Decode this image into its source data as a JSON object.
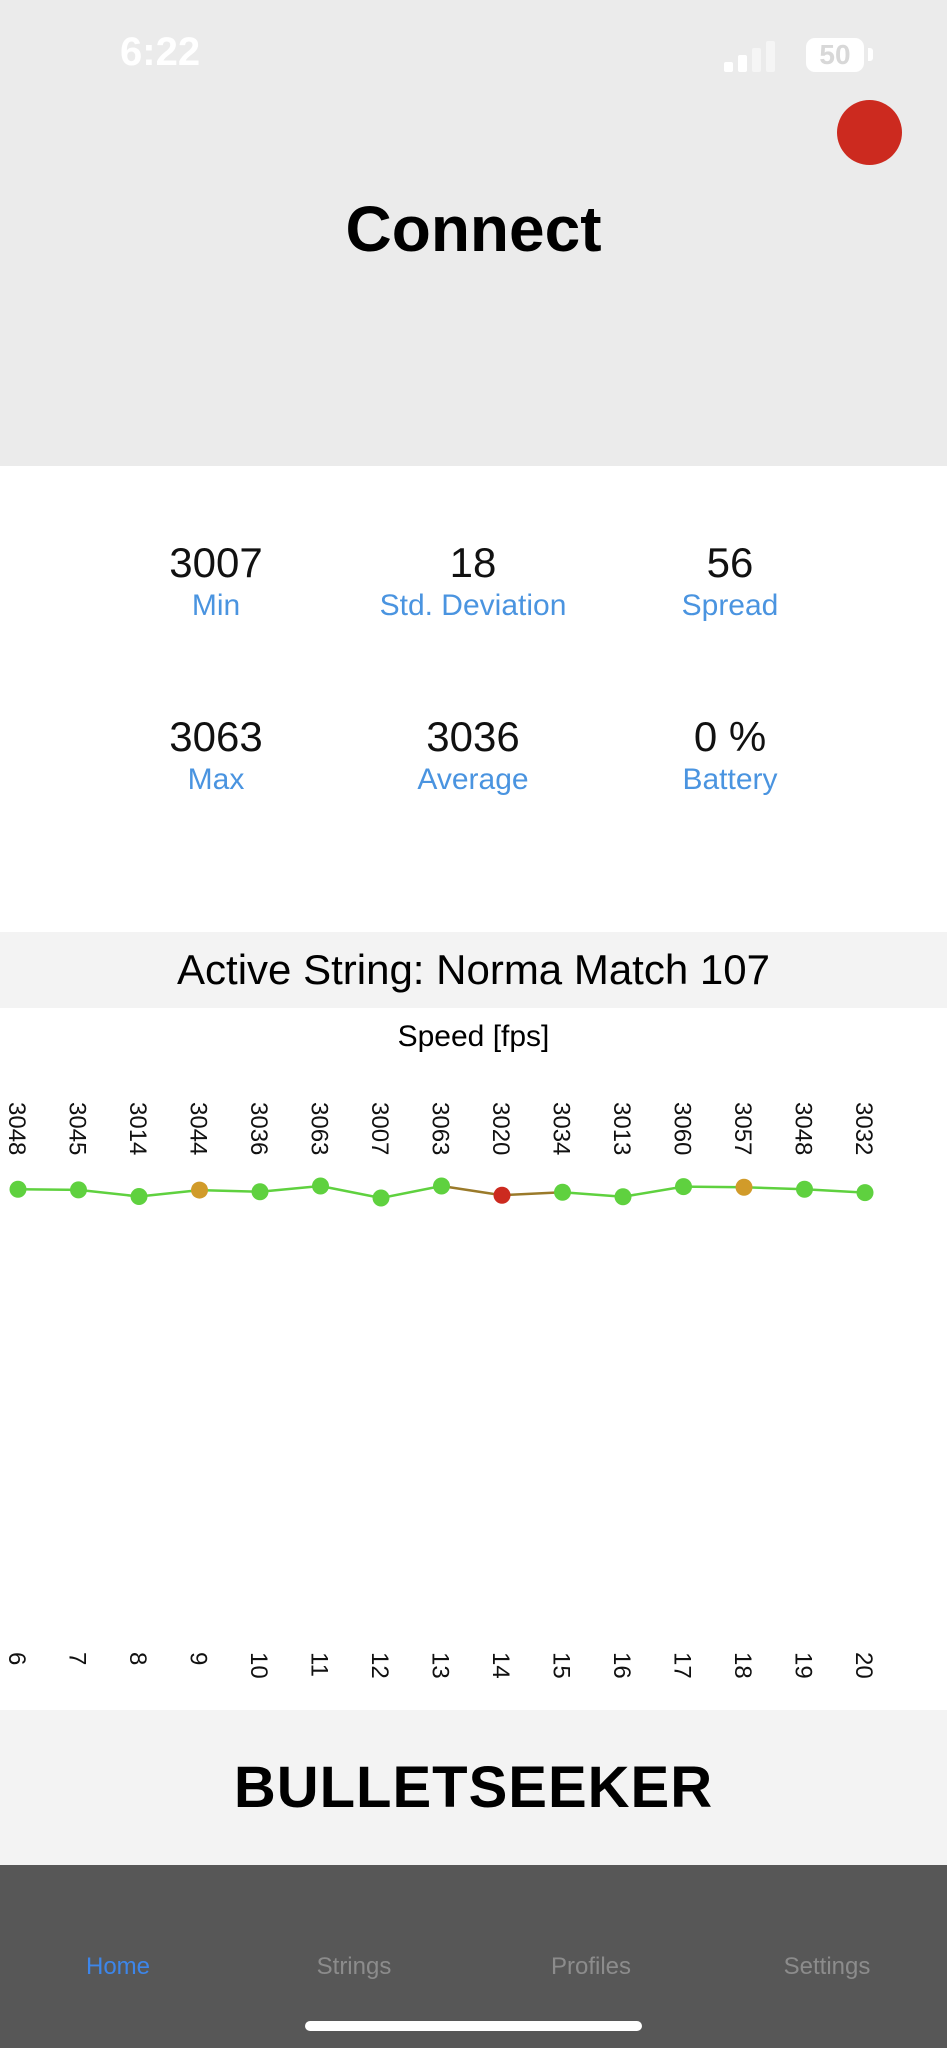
{
  "status_bar": {
    "time": "6:22",
    "battery": "50"
  },
  "header": {
    "title": "Connect"
  },
  "stats": [
    {
      "value": "3007",
      "label": "Min"
    },
    {
      "value": "18",
      "label": "Std. Deviation"
    },
    {
      "value": "56",
      "label": "Spread"
    },
    {
      "value": "3063",
      "label": "Max"
    },
    {
      "value": "3036",
      "label": "Average"
    },
    {
      "value": "0 %",
      "label": "Battery"
    }
  ],
  "active_string": "Active String: Norma Match 107",
  "chart_data": {
    "type": "line",
    "title": "Speed [fps]",
    "x": [
      6,
      7,
      8,
      9,
      10,
      11,
      12,
      13,
      14,
      15,
      16,
      17,
      18,
      19,
      20
    ],
    "values": [
      3048,
      3045,
      3014,
      3044,
      3036,
      3063,
      3007,
      3063,
      3020,
      3034,
      3013,
      3060,
      3057,
      3048,
      3032
    ],
    "point_colors": [
      "#5fd13f",
      "#5fd13f",
      "#5fd13f",
      "#d19b2a",
      "#5fd13f",
      "#5fd13f",
      "#5fd13f",
      "#5fd13f",
      "#cc2a1f",
      "#5fd13f",
      "#5fd13f",
      "#5fd13f",
      "#d19b2a",
      "#5fd13f",
      "#5fd13f"
    ],
    "line_color": "#5fd13f"
  },
  "brand": "BULLETSEEKER",
  "tabs": [
    {
      "label": "Home",
      "active": true
    },
    {
      "label": "Strings",
      "active": false
    },
    {
      "label": "Profiles",
      "active": false
    },
    {
      "label": "Settings",
      "active": false
    }
  ],
  "colors": {
    "accent": "#4a94e0",
    "record": "#cc2a1f",
    "tabbar": "#575757"
  }
}
